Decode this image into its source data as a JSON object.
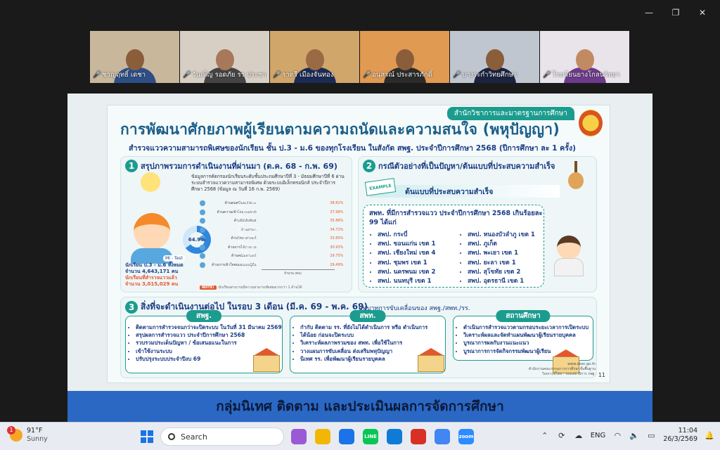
{
  "window": {
    "minimize": "—",
    "maximize": "❐",
    "close": "✕"
  },
  "participants": [
    {
      "name": "ชาญฤทธิ์ เดชา",
      "bg": "#c9b79c",
      "shirt": "#2d4f86",
      "skin": "#8a5d3b"
    },
    {
      "name": "วันเพ็ญ รอดภัย รร ประชาส...",
      "bg": "#d8cfc4",
      "shirt": "#444444",
      "skin": "#a7785a"
    },
    {
      "name": "ราตรี เมืองจันทอง",
      "bg": "#d0a66a",
      "shirt": "#1b2b55",
      "skin": "#9a6a45"
    },
    {
      "name": "อนุสรณ์ ประสารภักดิ์",
      "bg": "#e09a52",
      "shirt": "#2b2b2b",
      "skin": "#8a5d3b"
    },
    {
      "name": "บางระกำวิทยศึกษา",
      "bg": "#bfc6cf",
      "shirt": "#1a2340",
      "skin": "#8a5d3b"
    },
    {
      "name": "โรงเรียนยางโกลนวิทยา",
      "bg": "#e9e3ea",
      "shirt": "#6e3a8c",
      "skin": "#c28a62"
    }
  ],
  "poster": {
    "agency": "สำนักวิชาการและมาตรฐานการศึกษา",
    "title": "การพัฒนาศักยภาพผู้เรียนตามความถนัดและความสนใจ (พหุปัญญา)",
    "subtitle": "สำรวจแววความสามารถพิเศษของนักเรียน ชั้น ป.3 - ม.6 ของทุกโรงเรียน ในสังกัด สพฐ. ประจำปีการศึกษา 2568 (ปีการศึกษา ละ 1 ครั้ง)",
    "sec1": {
      "num": "1",
      "title": "สรุปภาพรวมการดำเนินงานที่ผ่านมา (ต.ค. 68 - ก.พ. 69)",
      "desc": "ข้อมูลการคัดกรองนักเรียนระดับชั้นประถมศึกษาปีที่ 3 - มัธยมศึกษาปีที่ 6 ผ่านระบบสำรวจแววความสามารถพิเศษ ด้วยระบบอิเล็กทรอนิกส์ ประจำปีการศึกษา 2568 (ข้อมูล ณ วันที่ 16 ก.พ. 2569)",
      "donut_label": "64.9%",
      "donut_value": 64.9,
      "mitest": "MI - Test",
      "students_label": "นักเรียน ป.3 - ม.6 ทั้งหมด",
      "students_value": "จำนวน 4,643,171 คน",
      "surveyed_label": "นักเรียนที่สำรวจแววแล้ว",
      "surveyed_value": "จำนวน 3,015,029 คน",
      "note_tag": "NOTE!",
      "note_text": "นักเรียนสามารถมีความสามารถพิเศษมากกว่า 1 ด้านได้",
      "axis_label": "จำนวน (คน)",
      "bars": [
        {
          "label": "ด้านดนตรีและจังหวะ",
          "value": 1170349,
          "display": "1,170,349 คน",
          "pct": "38.82%"
        },
        {
          "label": "ด้านความเข้าใจธรรมชาติ",
          "value": 1145176,
          "display": "1,145,176 คน",
          "pct": "37.98%"
        },
        {
          "label": "ด้านมิติสัมพันธ์",
          "value": 1081785,
          "display": "1,081,785 คน",
          "pct": "35.88%"
        },
        {
          "label": "ด้านภาษา",
          "value": 1046794,
          "display": "1,046,794 คน",
          "pct": "34.72%"
        },
        {
          "label": "ด้านวิทยาศาสตร์",
          "value": 1020597,
          "display": "1,020,597 คน",
          "pct": "33.85%"
        },
        {
          "label": "ด้านการใช้ร่างกาย",
          "value": 932643,
          "display": "932,643 คน",
          "pct": "30.93%"
        },
        {
          "label": "ด้านคณิตศาสตร์",
          "value": 896965,
          "display": "896,965 คน",
          "pct": "29.75%"
        },
        {
          "label": "ด้านการเข้าใจตนเองและผู้อื่น",
          "value": 888998,
          "display": "888,998 คน",
          "pct": "29.49%"
        }
      ]
    },
    "sec2": {
      "num": "2",
      "title": "กรณีตัวอย่างที่เป็นปัญหา/ต้นแบบที่ประสบความสำเร็จ",
      "example_tag": "EXAMPLE",
      "banner": "ต้นแบบที่ประสบความสำเร็จ",
      "lead": "สพท. ที่มีการสำรวจแวว ประจำปีการศึกษา 2568 เกินร้อยละ 99 ได้แก่",
      "left_list": [
        "สพป. กระบี่",
        "สพป. ขอนแก่น เขต 1",
        "สพป. เชียงใหม่ เขต 4",
        "สพป. ชุมพร เขต 1",
        "สพป. นครพนม เขต 2",
        "สพป. นนทบุรี เขต 1"
      ],
      "right_list": [
        "สพป. หนองบัวลำภู เขต 1",
        "สพป. ภูเก็ต",
        "สพป. พะเยา เขต 1",
        "สพป. ยะลา เขต 1",
        "สพป. สุโขทัย เขต 2",
        "สพป. อุดรธานี เขต 1"
      ]
    },
    "sec3": {
      "num": "3",
      "title": "สิ่งที่จะดำเนินงานต่อไป ในรอบ 3 เดือน (มี.ค. 69 - พ.ค. 69)",
      "via": "บทบาทการขับเคลื่อนของ สพฐ./สพท./รร.",
      "col1_title": "สพฐ.",
      "col1": [
        "ติดตามการสำรวจจนกว่าจะปิดระบบ ในวันที่ 31 มีนาคม 2569",
        "สรุปผลการสำรวจแวว ประจำปีการศึกษา 2568",
        "รวบรวมประเด็นปัญหา / ข้อเสนอแนะในการ",
        "เข้าใช้งานระบบ",
        "ปรับปรุงระบบประจำปีงบ 69"
      ],
      "col2_title": "สพท.",
      "col2": [
        "กำกับ ติดตาม รร. ที่ยังไม่ได้ดำเนินการ หรือ ดำเนินการ",
        "ได้น้อย ก่อนจะปิดระบบ",
        "วิเคราะห์ผลภาพรวมของ สพท. เพื่อใช้ในการ",
        "วางแผนการขับเคลื่อน ส่งเสริมพหุปัญญา",
        "นิเทศ รร. เพื่อพัฒนาผู้เรียนรายบุคคล"
      ],
      "col3_title": "สถานศึกษา",
      "col3": [
        "ดำเนินการสำรวจแววตามกรอบระยะเวลาการเปิดระบบ",
        "วิเคราะห์ผลและจัดทำแผนพัฒนาผู้เรียนรายบุคคล",
        "บูรณาการผลกับงานแนะแนว",
        "บูรณาการการจัดกิจกรรมพัฒนาผู้เรียน"
      ]
    },
    "footer_web": "www.obec.go.th",
    "footer_org": "สำนักงานคณะกรรมการการศึกษาขั้นพื้นฐาน",
    "footer_person": "วิเคราะห์โดย : รองเลขาธิการ กพฐ.",
    "page": "11"
  },
  "caption": "กลุ่มนิเทศ ติดตาม และประเมินผลการจัดการศึกษา",
  "taskbar": {
    "weather_badge": "1",
    "temp": "91°F",
    "cond": "Sunny",
    "search": "Search",
    "apps": [
      {
        "name": "copilot",
        "color": "#9b59d6",
        "text": ""
      },
      {
        "name": "file-explorer",
        "color": "#f2b705",
        "text": ""
      },
      {
        "name": "store",
        "color": "#1a73e8",
        "text": ""
      },
      {
        "name": "line",
        "color": "#06c755",
        "text": "LINE"
      },
      {
        "name": "edge",
        "color": "#0f7bd6",
        "text": ""
      },
      {
        "name": "acrobat",
        "color": "#d93025",
        "text": ""
      },
      {
        "name": "chrome",
        "color": "#4285f4",
        "text": ""
      },
      {
        "name": "zoom",
        "color": "#2d8cff",
        "text": "zoom"
      }
    ],
    "lang": "ENG",
    "time": "11:04",
    "date": "26/3/2569"
  }
}
